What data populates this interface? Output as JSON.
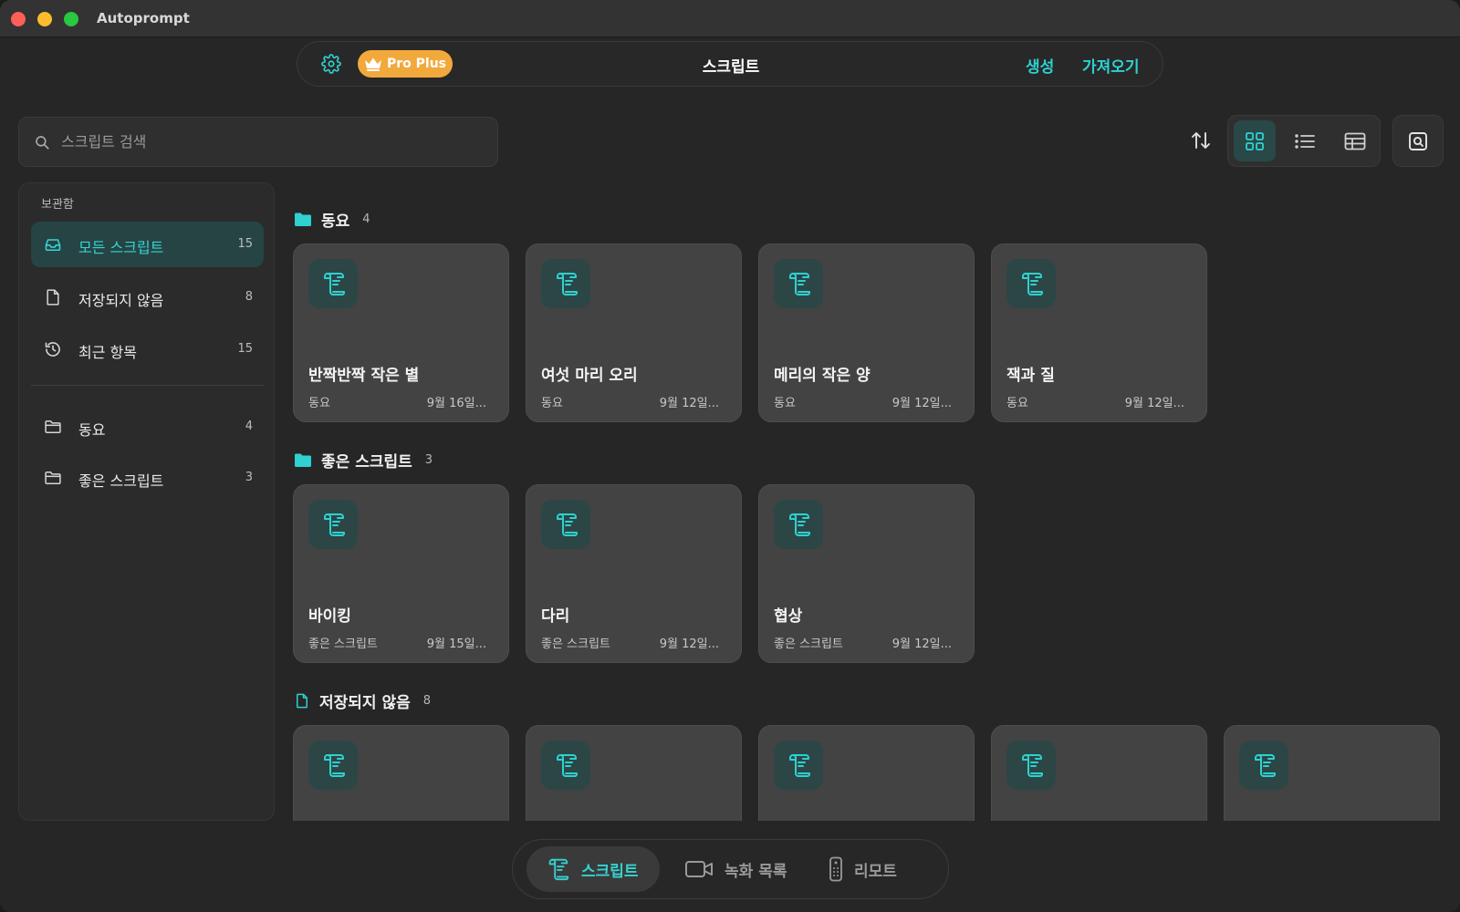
{
  "window": {
    "title": "Autoprompt"
  },
  "header": {
    "badge_label": "Pro Plus",
    "title": "스크립트",
    "create_label": "생성",
    "import_label": "가져오기"
  },
  "search": {
    "placeholder": "스크립트 검색",
    "value": ""
  },
  "toolbar": {
    "view_mode": "grid"
  },
  "sidebar": {
    "section_label": "보관함",
    "library": [
      {
        "label": "모든 스크립트",
        "count": "15",
        "icon": "inbox-icon",
        "active": true
      },
      {
        "label": "저장되지 않음",
        "count": "8",
        "icon": "document-icon",
        "active": false
      },
      {
        "label": "최근 항목",
        "count": "15",
        "icon": "history-icon",
        "active": false
      }
    ],
    "folders": [
      {
        "label": "동요",
        "count": "4",
        "icon": "folder-icon"
      },
      {
        "label": "좋은 스크립트",
        "count": "3",
        "icon": "folder-icon"
      }
    ]
  },
  "groups": [
    {
      "title": "동요",
      "count": "4",
      "icon": "folder-filled-icon",
      "cards": [
        {
          "title": "반짝반짝 작은 별",
          "folder": "동요",
          "date": "9월 16일..."
        },
        {
          "title": "여섯 마리 오리",
          "folder": "동요",
          "date": "9월 12일..."
        },
        {
          "title": "메리의 작은 양",
          "folder": "동요",
          "date": "9월 12일..."
        },
        {
          "title": "잭과 질",
          "folder": "동요",
          "date": "9월 12일..."
        }
      ]
    },
    {
      "title": "좋은 스크립트",
      "count": "3",
      "icon": "folder-filled-icon",
      "cards": [
        {
          "title": "바이킹",
          "folder": "좋은 스크립트",
          "date": "9월 15일..."
        },
        {
          "title": "다리",
          "folder": "좋은 스크립트",
          "date": "9월 12일..."
        },
        {
          "title": "협상",
          "folder": "좋은 스크립트",
          "date": "9월 12일..."
        }
      ]
    },
    {
      "title": "저장되지 않음",
      "count": "8",
      "icon": "document-icon",
      "cards": [
        {
          "title": "",
          "folder": "",
          "date": ""
        },
        {
          "title": "",
          "folder": "",
          "date": ""
        },
        {
          "title": "",
          "folder": "",
          "date": ""
        },
        {
          "title": "",
          "folder": "",
          "date": ""
        },
        {
          "title": "",
          "folder": "",
          "date": ""
        }
      ]
    }
  ],
  "tabbar": {
    "tabs": [
      {
        "label": "스크립트",
        "icon": "scroll-icon",
        "active": true
      },
      {
        "label": "녹화 목록",
        "icon": "video-camera-icon",
        "active": false
      },
      {
        "label": "리모트",
        "icon": "remote-icon",
        "active": false
      }
    ]
  },
  "colors": {
    "accent": "#2fd1d1",
    "badge": "#f2a93b",
    "card": "#434343",
    "background": "#262626"
  }
}
